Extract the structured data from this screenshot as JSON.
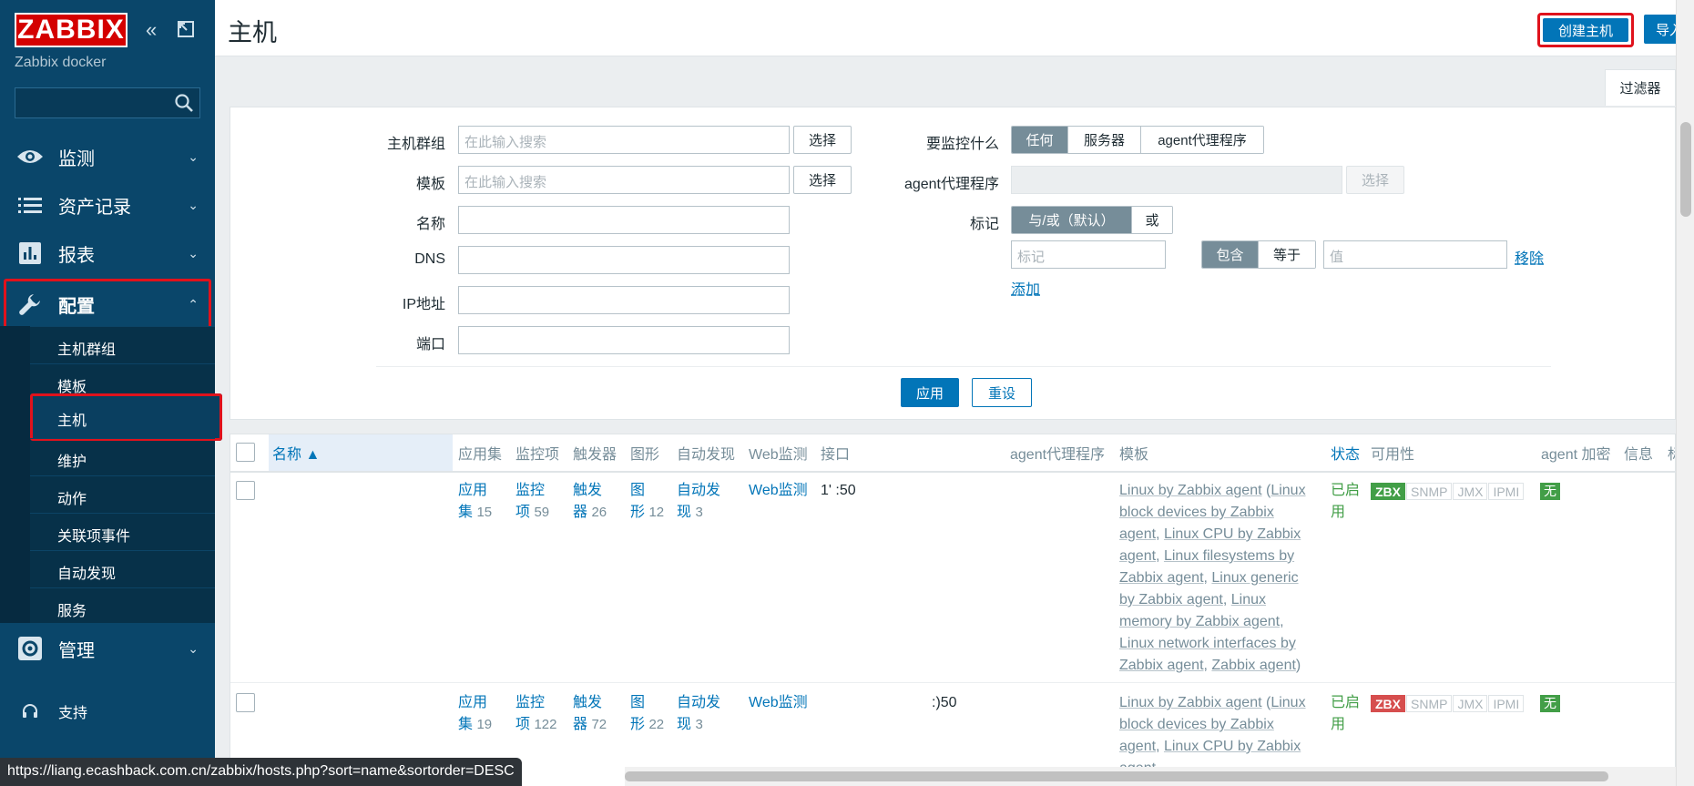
{
  "sidebar": {
    "logo": "ZABBIX",
    "server_name": "Zabbix docker",
    "collapse_icon": "double-chevron-left-icon",
    "kiosk_icon": "kiosk-mode-icon",
    "search_placeholder": "",
    "menu": [
      {
        "label": "监测",
        "icon": "eye-icon"
      },
      {
        "label": "资产记录",
        "icon": "list-icon"
      },
      {
        "label": "报表",
        "icon": "bar-chart-icon"
      },
      {
        "label": "配置",
        "icon": "wrench-icon"
      },
      {
        "label": "管理",
        "icon": "gear-icon"
      },
      {
        "label": "支持",
        "icon": "headset-icon"
      }
    ],
    "submenu": [
      "主机群组",
      "模板",
      "主机",
      "维护",
      "动作",
      "关联项事件",
      "自动发现",
      "服务"
    ]
  },
  "header": {
    "title": "主机",
    "create_host": "创建主机",
    "import": "导入"
  },
  "filter": {
    "tab_label": "过滤器",
    "host_groups_label": "主机群组",
    "templates_label": "模板",
    "name_label": "名称",
    "dns_label": "DNS",
    "ip_label": "IP地址",
    "port_label": "端口",
    "search_placeholder": "在此输入搜索",
    "select": "选择",
    "monitored_by_label": "要监控什么",
    "monitored_by_options": [
      "任何",
      "服务器",
      "agent代理程序"
    ],
    "proxy_label": "agent代理程序",
    "tags_label": "标记",
    "tags_eval_options": [
      "与/或（默认）",
      "或"
    ],
    "tag_placeholder": "标记",
    "tag_operators": [
      "包含",
      "等于"
    ],
    "value_placeholder": "值",
    "remove": "移除",
    "add": "添加",
    "apply": "应用",
    "reset": "重设"
  },
  "table": {
    "headers": {
      "name": "名称 ▲",
      "applications": "应用集",
      "items": "监控项",
      "triggers": "触发器",
      "graphs": "图形",
      "discovery": "自动发现",
      "web": "Web监测",
      "interface": "接口",
      "proxy": "agent代理程序",
      "templates": "模板",
      "status": "状态",
      "availability": "可用性",
      "encryption": "agent 加密",
      "info": "信息",
      "tags": "标"
    },
    "rows": [
      {
        "app_a": "应用",
        "app_b": "集",
        "app_count": "15",
        "items_a": "监控",
        "items_b": "项",
        "items_count": "59",
        "trig_a": "触发",
        "trig_b": "器",
        "trig_count": "26",
        "graph_a": "图",
        "graph_b": "形",
        "graph_count": "12",
        "disc_a": "自动发",
        "disc_b": "现",
        "disc_count": "3",
        "web": "Web监测",
        "interface": "1'            :50",
        "templates": [
          "Linux by Zabbix agent",
          "Linux block devices by Zabbix agent",
          "Linux CPU by Zabbix agent",
          "Linux filesystems by Zabbix agent",
          "Linux generic by Zabbix agent",
          "Linux memory by Zabbix agent",
          "Linux network interfaces by Zabbix agent",
          "Zabbix agent"
        ],
        "status": "已启用",
        "zbx_state": "ok",
        "encryption": "无"
      },
      {
        "app_a": "应用",
        "app_b": "集",
        "app_count": "19",
        "items_a": "监控",
        "items_b": "项",
        "items_count": "122",
        "trig_a": "触发",
        "trig_b": "器",
        "trig_count": "72",
        "graph_a": "图",
        "graph_b": "形",
        "graph_count": "22",
        "disc_a": "自动发",
        "disc_b": "现",
        "disc_count": "3",
        "web": "Web监测",
        "interface": ":)50",
        "templates": [
          "Linux by Zabbix agent",
          "Linux block devices by Zabbix agent",
          "Linux CPU by Zabbix agent"
        ],
        "status": "已启用",
        "zbx_state": "bad",
        "encryption": "无"
      }
    ],
    "availability_badges": [
      "ZBX",
      "SNMP",
      "JMX",
      "IPMI"
    ]
  },
  "statusbar": "https://liang.ecashback.com.cn/zabbix/hosts.php?sort=name&sortorder=DESC",
  "colors": {
    "sidebar_bg": "#0a466a",
    "accent": "#0275b8",
    "highlight": "#e0121c",
    "ok": "#429e47",
    "bad": "#d64e4e"
  }
}
